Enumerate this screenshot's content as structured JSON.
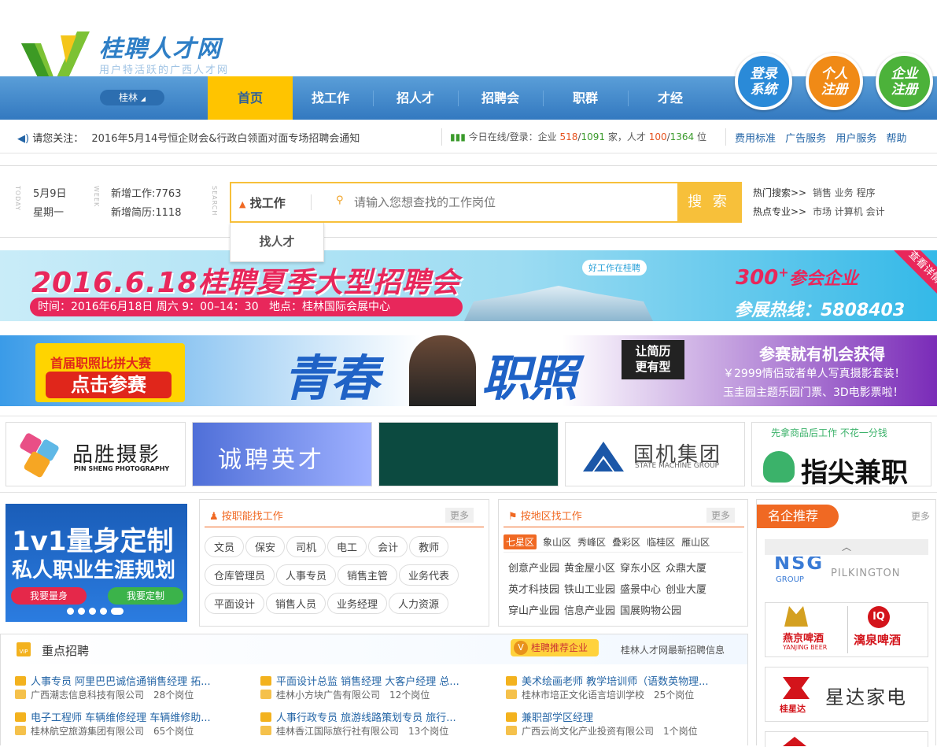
{
  "logo": {
    "title": "桂聘人才网",
    "subtitle": "用户特活跃的广西人才网"
  },
  "nav": {
    "city": "桂林",
    "items": [
      "首页",
      "找工作",
      "招人才",
      "招聘会",
      "职群",
      "才经"
    ]
  },
  "circles": [
    {
      "l1": "登录",
      "l2": "系统"
    },
    {
      "l1": "个人",
      "l2": "注册"
    },
    {
      "l1": "企业",
      "l2": "注册"
    }
  ],
  "notice": {
    "label": "请您关注：",
    "text": "2016年5月14号恒企财会&行政白领面对面专场招聘会通知"
  },
  "stats": {
    "prefix": "今日在线/登录：企业",
    "a": "518",
    "sep1": "/",
    "b": "1091",
    "mid": "家，人才",
    "c": "100",
    "sep2": "/",
    "d": "1364",
    "suffix": "位"
  },
  "toplinks": [
    "费用标准",
    "广告服务",
    "用户服务",
    "帮助"
  ],
  "datebox": {
    "date": "5月9日",
    "weekday": "星期一",
    "new_jobs": "新增工作:7763",
    "new_resumes": "新增简历:1118",
    "today": "TODAY",
    "week": "WEEK",
    "search": "SEARCH"
  },
  "search": {
    "type": "找工作",
    "placeholder": "请输入您想查找的工作岗位",
    "button": "搜 索",
    "dropdown": "找人才"
  },
  "hot": {
    "label1": "热门搜索>>",
    "items1": [
      "销售",
      "业务",
      "程序"
    ],
    "label2": "热点专业>>",
    "items2": [
      "市场",
      "计算机",
      "会计"
    ]
  },
  "banner1": {
    "title": "2016.6.18桂聘夏季大型招聘会",
    "time": "时间：2016年6月18日 周六 9：00–14：30",
    "place": "地点：桂林国际会展中心",
    "tag": "好工作在桂聘",
    "count": "300",
    "plus": "+",
    "count_suffix": "参会企业",
    "hotline": "参展热线：5808403",
    "corner": "查看详情"
  },
  "banner2": {
    "left1": "首届职照比拼大赛",
    "left2": "点击参赛",
    "big1": "青春",
    "big2": "职照",
    "badge1": "让简历",
    "badge2": "更有型",
    "r1": "参赛就有机会获得",
    "r2": "￥2999情侣或者单人写真摄影套装！",
    "r3": "玉圭园主题乐园门票、3D电影票啦！"
  },
  "logos": [
    {
      "name": "品胜摄影",
      "sub": "PIN SHENG PHOTOGRAPHY"
    },
    {
      "name": "诚聘英才"
    },
    {
      "name": ""
    },
    {
      "name": "国机集团",
      "sub": "STATE MACHINE GROUP"
    },
    {
      "top": "先拿商品后工作 不花一分钱",
      "name": "指尖兼职"
    }
  ],
  "promo": {
    "l1": "1v1量身定制",
    "l2": "私人职业生涯规划",
    "b1": "我要量身",
    "b2": "我要定制"
  },
  "byfunc": {
    "title": "按职能找工作",
    "more": "更多",
    "tags": [
      "文员",
      "保安",
      "司机",
      "电工",
      "会计",
      "教师",
      "仓库管理员",
      "人事专员",
      "销售主管",
      "业务代表",
      "平面设计",
      "销售人员",
      "业务经理",
      "人力资源"
    ]
  },
  "byarea": {
    "title": "按地区找工作",
    "more": "更多",
    "areas": [
      "七星区",
      "象山区",
      "秀峰区",
      "叠彩区",
      "临桂区",
      "雁山区"
    ],
    "places": [
      "创意产业园",
      "黄金屋小区",
      "穿东小区",
      "众鼎大厦",
      "英才科技园",
      "铁山工业园",
      "盛景中心",
      "创业大厦",
      "穿山产业园",
      "信息产业园",
      "国展购物公园"
    ]
  },
  "mingqi": {
    "title": "名企推荐",
    "more": "更多",
    "b1": "PILKINGTON",
    "b1sub": "GROUP",
    "b2a": "燕京啤酒",
    "b2b": "漓泉啤酒",
    "b2c": "YANJING BEER",
    "b3": "星达家电",
    "b3sub": "桂星达"
  },
  "key": {
    "title": "重点招聘",
    "badge": "桂聘推荐企业",
    "right": "桂林人才网最新招聘信息",
    "items": [
      {
        "jobs": "人事专员  阿里巴巴诚信通销售经理  拓...",
        "company": "广西潮志信息科技有限公司",
        "count": "28个岗位"
      },
      {
        "jobs": "平面设计总监  销售经理  大客户经理  总...",
        "company": "桂林小方块广告有限公司",
        "count": "12个岗位"
      },
      {
        "jobs": "美术绘画老师  教学培训师（语数英物理...",
        "company": "桂林市培正文化语言培训学校",
        "count": "25个岗位"
      },
      {
        "jobs": "电子工程师  车辆维修经理  车辆维修助...",
        "company": "桂林航空旅游集团有限公司",
        "count": "65个岗位"
      },
      {
        "jobs": "人事行政专员  旅游线路策划专员  旅行...",
        "company": "桂林香江国际旅行社有限公司",
        "count": "13个岗位"
      },
      {
        "jobs": "兼职部学区经理",
        "company": "广西云尚文化产业投资有限公司",
        "count": "1个岗位"
      }
    ]
  },
  "colors": {
    "nav_blue": "#3f86cc",
    "accent_yellow": "#ffc400",
    "circle_blue": "#2a8ad8",
    "circle_orange": "#f08a16",
    "circle_green": "#4cb23a",
    "orange": "#f06923"
  }
}
